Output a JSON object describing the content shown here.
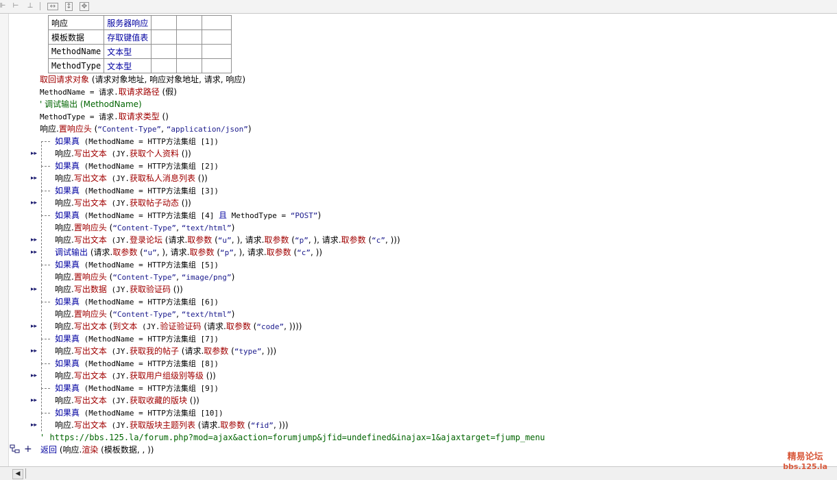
{
  "toolbar": {
    "icons": [
      "align-left-icon",
      "align-hspace-icon",
      "align-vspace-icon",
      "width-icon",
      "height-icon",
      "size-icon"
    ]
  },
  "var_table": {
    "rows": [
      {
        "name": "响应",
        "type": "服务器响应"
      },
      {
        "name": "模板数据",
        "type": "存取键值表"
      },
      {
        "name": "MethodName",
        "type": "文本型"
      },
      {
        "name": "MethodType",
        "type": "文本型"
      }
    ]
  },
  "code": {
    "l1_fn": "取回请求对象",
    "l1_args": " (请求对象地址, 响应对象地址, 请求, 响应)",
    "l2_a": "MethodName = 请求.",
    "l2_fn": "取请求路径",
    "l2_b": " (假)",
    "l3": "' 调试输出 (MethodName)",
    "l4_a": "MethodType = 请求.",
    "l4_fn": "取请求类型",
    "l4_b": " ()",
    "l5_a": "响应.",
    "l5_fn": "置响应头",
    "l5_b": " (",
    "l5_s1": "“Content-Type”",
    "l5_c": ", ",
    "l5_s2": "“application/json”",
    "l5_d": ")",
    "if1_kw": "如果真",
    "if1_b": " (MethodName = HTTP方法集组 [1])",
    "w1_a": "响应.",
    "w1_fn": "写出文本",
    "w1_b": " (JY.",
    "w1_fn2": "获取个人资料",
    "w1_c": " ())",
    "if2_kw": "如果真",
    "if2_b": " (MethodName = HTTP方法集组 [2])",
    "w2_a": "响应.",
    "w2_fn": "写出文本",
    "w2_b": " (JY.",
    "w2_fn2": "获取私人消息列表",
    "w2_c": " ())",
    "if3_kw": "如果真",
    "if3_b": " (MethodName = HTTP方法集组 [3])",
    "w3_a": "响应.",
    "w3_fn": "写出文本",
    "w3_b": " (JY.",
    "w3_fn2": "获取帖子动态",
    "w3_c": " ())",
    "if4_kw": "如果真",
    "if4_b": " (MethodName = HTTP方法集组 [4] ",
    "if4_and": "且",
    "if4_c": " MethodType = ",
    "if4_s": "“POST”",
    "if4_d": ")",
    "h4_a": "响应.",
    "h4_fn": "置响应头",
    "h4_b": " (",
    "h4_s1": "“Content-Type”",
    "h4_c": ", ",
    "h4_s2": "“text/html”",
    "h4_d": ")",
    "w4_a": "响应.",
    "w4_fn": "写出文本",
    "w4_b": " (JY.",
    "w4_fn2": "登录论坛",
    "w4_c": " (请求.",
    "w4_fn3": "取参数",
    "w4_d": " (",
    "w4_s1": "“u”",
    "w4_e": ", ), 请求.",
    "w4_fn4": "取参数",
    "w4_f": " (",
    "w4_s2": "“p”",
    "w4_g": ", ), 请求.",
    "w4_fn5": "取参数",
    "w4_h": " (",
    "w4_s3": "“c”",
    "w4_i": ", )))",
    "d4_fn": "调试输出",
    "d4_b": " (请求.",
    "d4_fn2": "取参数",
    "d4_c": " (",
    "d4_s1": "“u”",
    "d4_d": ", ), 请求.",
    "d4_fn3": "取参数",
    "d4_e": " (",
    "d4_s2": "“p”",
    "d4_f": ", ), 请求.",
    "d4_fn4": "取参数",
    "d4_g": " (",
    "d4_s3": "“c”",
    "d4_h": ", ))",
    "if5_kw": "如果真",
    "if5_b": " (MethodName = HTTP方法集组 [5])",
    "h5_a": "响应.",
    "h5_fn": "置响应头",
    "h5_b": " (",
    "h5_s1": "“Content-Type”",
    "h5_c": ", ",
    "h5_s2": "“image/png”",
    "h5_d": ")",
    "w5_a": "响应.",
    "w5_fn": "写出数据",
    "w5_b": " (JY.",
    "w5_fn2": "获取验证码",
    "w5_c": " ())",
    "if6_kw": "如果真",
    "if6_b": " (MethodName = HTTP方法集组 [6])",
    "h6_a": "响应.",
    "h6_fn": "置响应头",
    "h6_b": " (",
    "h6_s1": "“Content-Type”",
    "h6_c": ", ",
    "h6_s2": "“text/html”",
    "h6_d": ")",
    "w6_a": "响应.",
    "w6_fn": "写出文本",
    "w6_b": " (",
    "w6_fn2": "到文本",
    "w6_c": " (JY.",
    "w6_fn3": "验证验证码",
    "w6_d": " (请求.",
    "w6_fn4": "取参数",
    "w6_e": " (",
    "w6_s1": "“code”",
    "w6_f": ", ))))",
    "if7_kw": "如果真",
    "if7_b": " (MethodName = HTTP方法集组 [7])",
    "w7_a": "响应.",
    "w7_fn": "写出文本",
    "w7_b": " (JY.",
    "w7_fn2": "获取我的帖子",
    "w7_c": " (请求.",
    "w7_fn3": "取参数",
    "w7_d": " (",
    "w7_s1": "“type”",
    "w7_e": ", )))",
    "if8_kw": "如果真",
    "if8_b": " (MethodName = HTTP方法集组 [8])",
    "w8_a": "响应.",
    "w8_fn": "写出文本",
    "w8_b": " (JY.",
    "w8_fn2": "获取用户组级别等级",
    "w8_c": " ())",
    "if9_kw": "如果真",
    "if9_b": " (MethodName = HTTP方法集组 [9])",
    "w9_a": "响应.",
    "w9_fn": "写出文本",
    "w9_b": " (JY.",
    "w9_fn2": "获取收藏的版块",
    "w9_c": " ())",
    "if10_kw": "如果真",
    "if10_b": " (MethodName = HTTP方法集组 [10])",
    "w10_a": "响应.",
    "w10_fn": "写出文本",
    "w10_b": " (JY.",
    "w10_fn2": "获取版块主题列表",
    "w10_c": " (请求.",
    "w10_fn3": "取参数",
    "w10_d": " (",
    "w10_s1": "“fid”",
    "w10_e": ", )))",
    "url": "' https://bbs.125.la/forum.php?mod=ajax&action=forumjump&jfid=undefined&inajax=1&ajaxtarget=fjump_menu",
    "ret_kw": "返回",
    "ret_b": " (响应.",
    "ret_fn": "渲染",
    "ret_c": " (模板数据, , ))"
  },
  "watermark": {
    "line1": "精易论坛",
    "line2": "bbs.125.la"
  },
  "colors": {
    "keyword": "#0000a0",
    "function": "#a00000",
    "string": "#1a1a8c",
    "comment": "#006400",
    "watermark": "#d8583a"
  }
}
